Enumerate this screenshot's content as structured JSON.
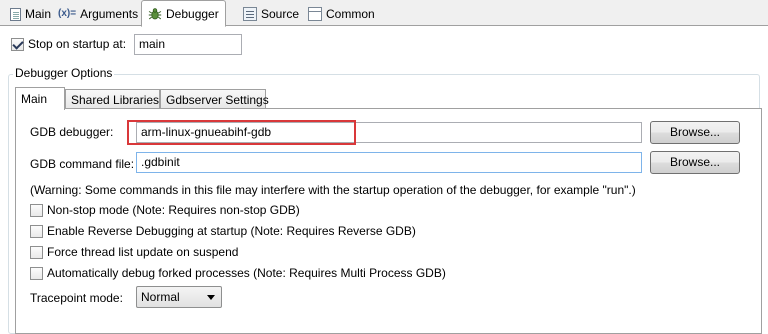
{
  "tabs": [
    {
      "label": "Main",
      "icon": "main-config-icon"
    },
    {
      "label": "Arguments",
      "icon": "arguments-icon",
      "icon_text": "(x)="
    },
    {
      "label": "Debugger",
      "icon": "debugger-icon",
      "active": true
    },
    {
      "label": "Source",
      "icon": "source-icon"
    },
    {
      "label": "Common",
      "icon": "common-icon"
    }
  ],
  "stop_on_startup": {
    "label": "Stop on startup at:",
    "checked": true,
    "value": "main"
  },
  "debugger_options": {
    "group_label": "Debugger Options",
    "tabs": [
      {
        "label": "Main",
        "active": true
      },
      {
        "label": "Shared Libraries"
      },
      {
        "label": "Gdbserver Settings"
      }
    ],
    "gdb_debugger": {
      "label": "GDB debugger:",
      "value": "arm-linux-gnueabihf-gdb",
      "browse": "Browse..."
    },
    "gdb_command_file": {
      "label": "GDB command file:",
      "value": ".gdbinit",
      "browse": "Browse..."
    },
    "warning": "(Warning: Some commands in this file may interfere with the startup operation of the debugger, for example \"run\".)",
    "options": [
      {
        "label": "Non-stop mode (Note: Requires non-stop GDB)",
        "checked": false
      },
      {
        "label": "Enable Reverse Debugging at startup (Note: Requires Reverse GDB)",
        "checked": false
      },
      {
        "label": "Force thread list update on suspend",
        "checked": false
      },
      {
        "label": "Automatically debug forked processes (Note: Requires Multi Process GDB)",
        "checked": false
      }
    ],
    "tracepoint": {
      "label": "Tracepoint mode:",
      "value": "Normal"
    }
  },
  "colors": {
    "highlight": "#d9383a",
    "focus_border": "#7eb4ea"
  }
}
